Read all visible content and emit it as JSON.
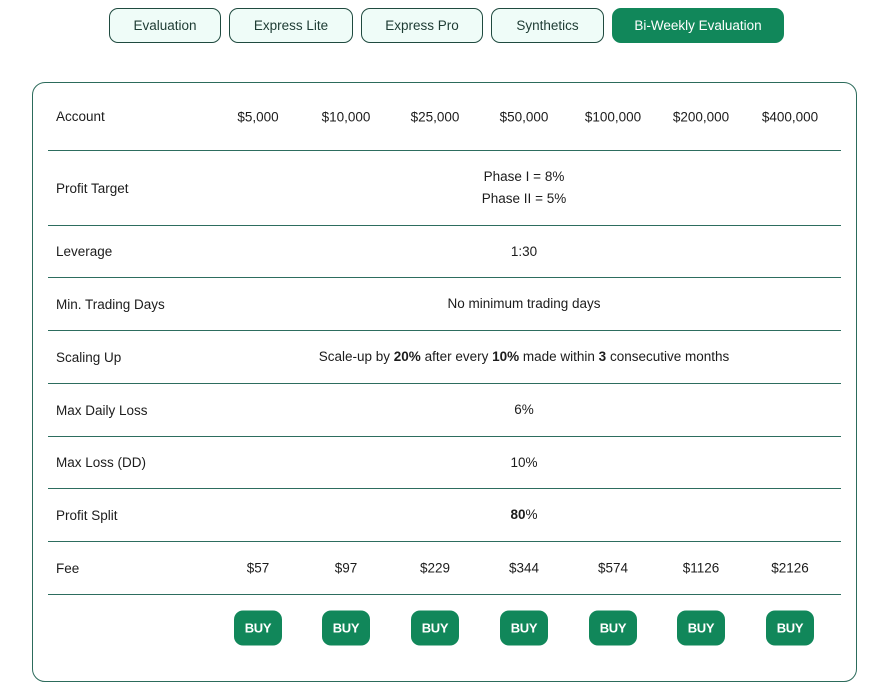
{
  "tabs": [
    {
      "label": "Evaluation",
      "active": false
    },
    {
      "label": "Express Lite",
      "active": false
    },
    {
      "label": "Express Pro",
      "active": false
    },
    {
      "label": "Synthetics",
      "active": false
    },
    {
      "label": "Bi-Weekly Evaluation",
      "active": true
    }
  ],
  "colors": {
    "accent": "#11875a",
    "tab_bg": "#effcf8",
    "border": "#2c6b5b"
  },
  "table": {
    "account": {
      "label": "Account",
      "values": [
        "$5,000",
        "$10,000",
        "$25,000",
        "$50,000",
        "$100,000",
        "$200,000",
        "$400,000"
      ]
    },
    "profit_target": {
      "label": "Profit Target",
      "line1": "Phase I = 8%",
      "line2": "Phase II = 5%"
    },
    "leverage": {
      "label": "Leverage",
      "value": "1:30"
    },
    "min_trading_days": {
      "label": "Min. Trading Days",
      "value": "No minimum trading days"
    },
    "scaling_up": {
      "label": "Scaling Up",
      "parts": [
        "Scale-up by ",
        "20%",
        " after every ",
        "10%",
        " made within ",
        "3",
        " consecutive months"
      ]
    },
    "max_daily_loss": {
      "label": "Max Daily Loss",
      "value": "6%"
    },
    "max_loss": {
      "label": "Max Loss (DD)",
      "value": "10%"
    },
    "profit_split": {
      "label": "Profit Split",
      "value_bold": "80",
      "value_suffix": "%"
    },
    "fee": {
      "label": "Fee",
      "values": [
        "$57",
        "$97",
        "$229",
        "$344",
        "$574",
        "$1126",
        "$2126"
      ]
    },
    "buy_label": "BUY"
  }
}
